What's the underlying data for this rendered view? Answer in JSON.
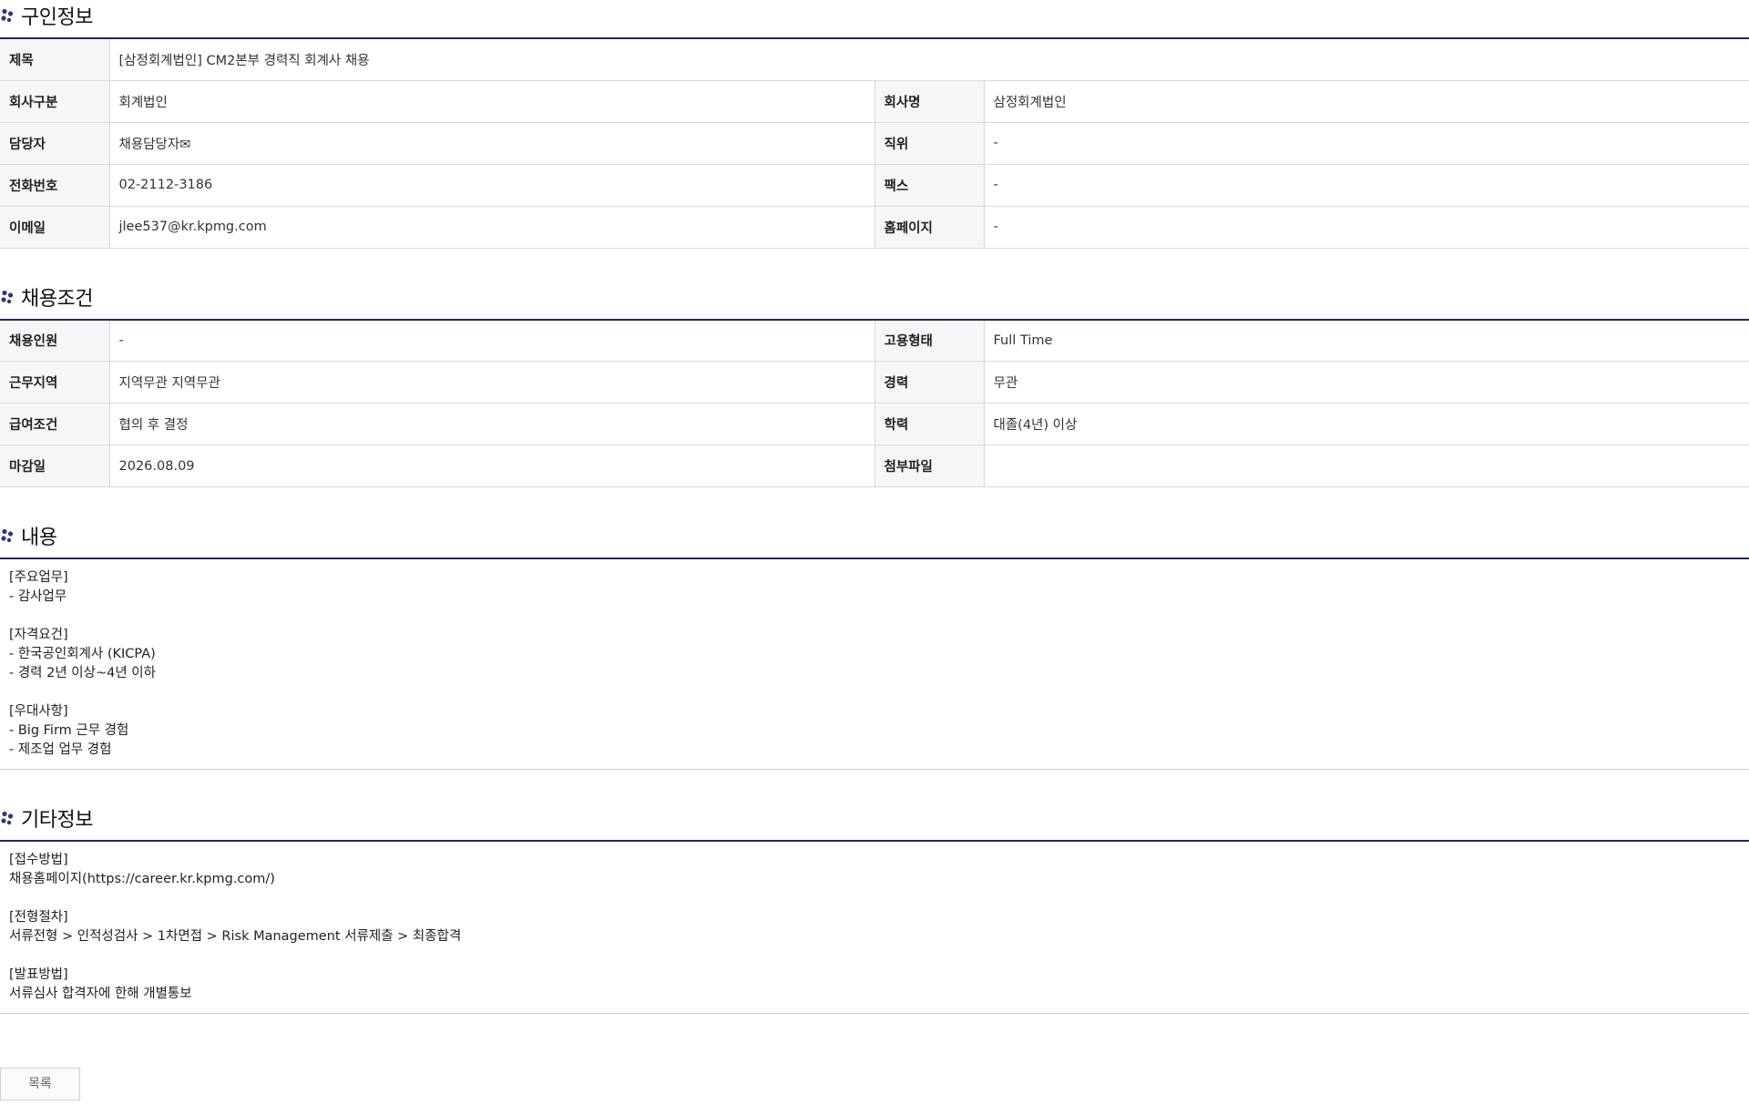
{
  "sections": {
    "job_info": "구인정보",
    "conditions": "채용조건",
    "content": "내용",
    "etc": "기타정보"
  },
  "job_info": {
    "title_label": "제목",
    "title_value": "[삼정회계법인] CM2본부 경력직 회계사 채용",
    "company_type_label": "회사구분",
    "company_type_value": "회계법인",
    "company_name_label": "회사명",
    "company_name_value": "삼정회계법인",
    "manager_label": "담당자",
    "manager_value": "채용담당자",
    "position_label": "직위",
    "position_value": "-",
    "phone_label": "전화번호",
    "phone_value": "02-2112-3186",
    "fax_label": "팩스",
    "fax_value": "-",
    "email_label": "이메일",
    "email_value": "jlee537@kr.kpmg.com",
    "homepage_label": "홈페이지",
    "homepage_value": "-"
  },
  "conditions": {
    "headcount_label": "채용인원",
    "headcount_value": "-",
    "employment_type_label": "고용형태",
    "employment_type_value": "Full Time",
    "location_label": "근무지역",
    "location_value": "지역무관 지역무관",
    "experience_label": "경력",
    "experience_value": "무관",
    "salary_label": "급여조건",
    "salary_value": "협의 후 결정",
    "education_label": "학력",
    "education_value": "대졸(4년) 이상",
    "deadline_label": "마감일",
    "deadline_value": "2026.08.09",
    "attachment_label": "첨부파일",
    "attachment_value": ""
  },
  "content": {
    "l1": "[주요업무]",
    "l2": "- 감사업무",
    "l3": "[자격요건]",
    "l4": "- 한국공인회계사 (KICPA)",
    "l5": "- 경력 2년 이상~4년 이하",
    "l6": "[우대사항]",
    "l7": "- Big Firm 근무 경험",
    "l8": "- 제조업 업무 경험"
  },
  "etc": {
    "l1": "[접수방법]",
    "l2": "채용홈페이지(https://career.kr.kpmg.com/)",
    "l3": "[전형절차]",
    "l4": "서류전형 > 인적성검사 > 1차면접 > Risk Management 서류제출 > 최종합격",
    "l5": "[발표방법]",
    "l6": "서류심사 합격자에 한해 개별통보"
  },
  "buttons": {
    "list": "목록"
  },
  "colors": {
    "accent": "#1f2a57",
    "bullet": "#2b3a7a"
  }
}
